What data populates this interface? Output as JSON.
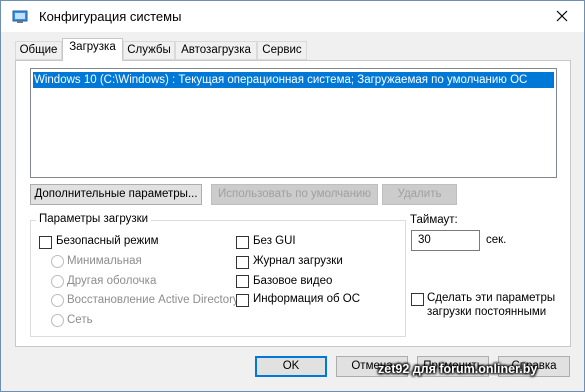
{
  "window": {
    "title": "Конфигурация системы"
  },
  "tabs": [
    {
      "label": "Общие"
    },
    {
      "label": "Загрузка"
    },
    {
      "label": "Службы"
    },
    {
      "label": "Автозагрузка"
    },
    {
      "label": "Сервис"
    }
  ],
  "active_tab": "Загрузка",
  "boot_entries": [
    {
      "label": "Windows 10 (C:\\Windows) : Текущая операционная система; Загружаемая по умолчанию ОС",
      "selected": true
    }
  ],
  "buttons": {
    "advanced": "Дополнительные параметры...",
    "set_default": "Использовать по умолчанию",
    "delete": "Удалить"
  },
  "boot_options": {
    "title": "Параметры загрузки",
    "safe_boot": {
      "label": "Безопасный режим",
      "checked": false
    },
    "minimal": {
      "label": "Минимальная"
    },
    "alternate_shell": {
      "label": "Другая оболочка"
    },
    "ad_repair": {
      "label": "Восстановление Active Directory"
    },
    "network": {
      "label": "Сеть"
    },
    "no_gui": {
      "label": "Без GUI",
      "checked": false
    },
    "boot_log": {
      "label": "Журнал загрузки",
      "checked": false
    },
    "base_video": {
      "label": "Базовое видео",
      "checked": false
    },
    "os_info": {
      "label": "Информация  об ОС",
      "checked": false
    }
  },
  "timeout": {
    "label": "Таймаут:",
    "value": "30",
    "unit": "сек."
  },
  "permanent": {
    "label_line1": "Сделать эти параметры",
    "label_line2": "загрузки постоянными",
    "checked": false
  },
  "footer": {
    "ok": "OK",
    "cancel": "Отмена",
    "apply": "Применить",
    "help": "Справка"
  },
  "watermark": "zet92 для forum.onliner.by",
  "colors": {
    "selection": "#0078d7",
    "dialog_bg": "#f0f0f0",
    "border_blue": "#0078d7"
  }
}
